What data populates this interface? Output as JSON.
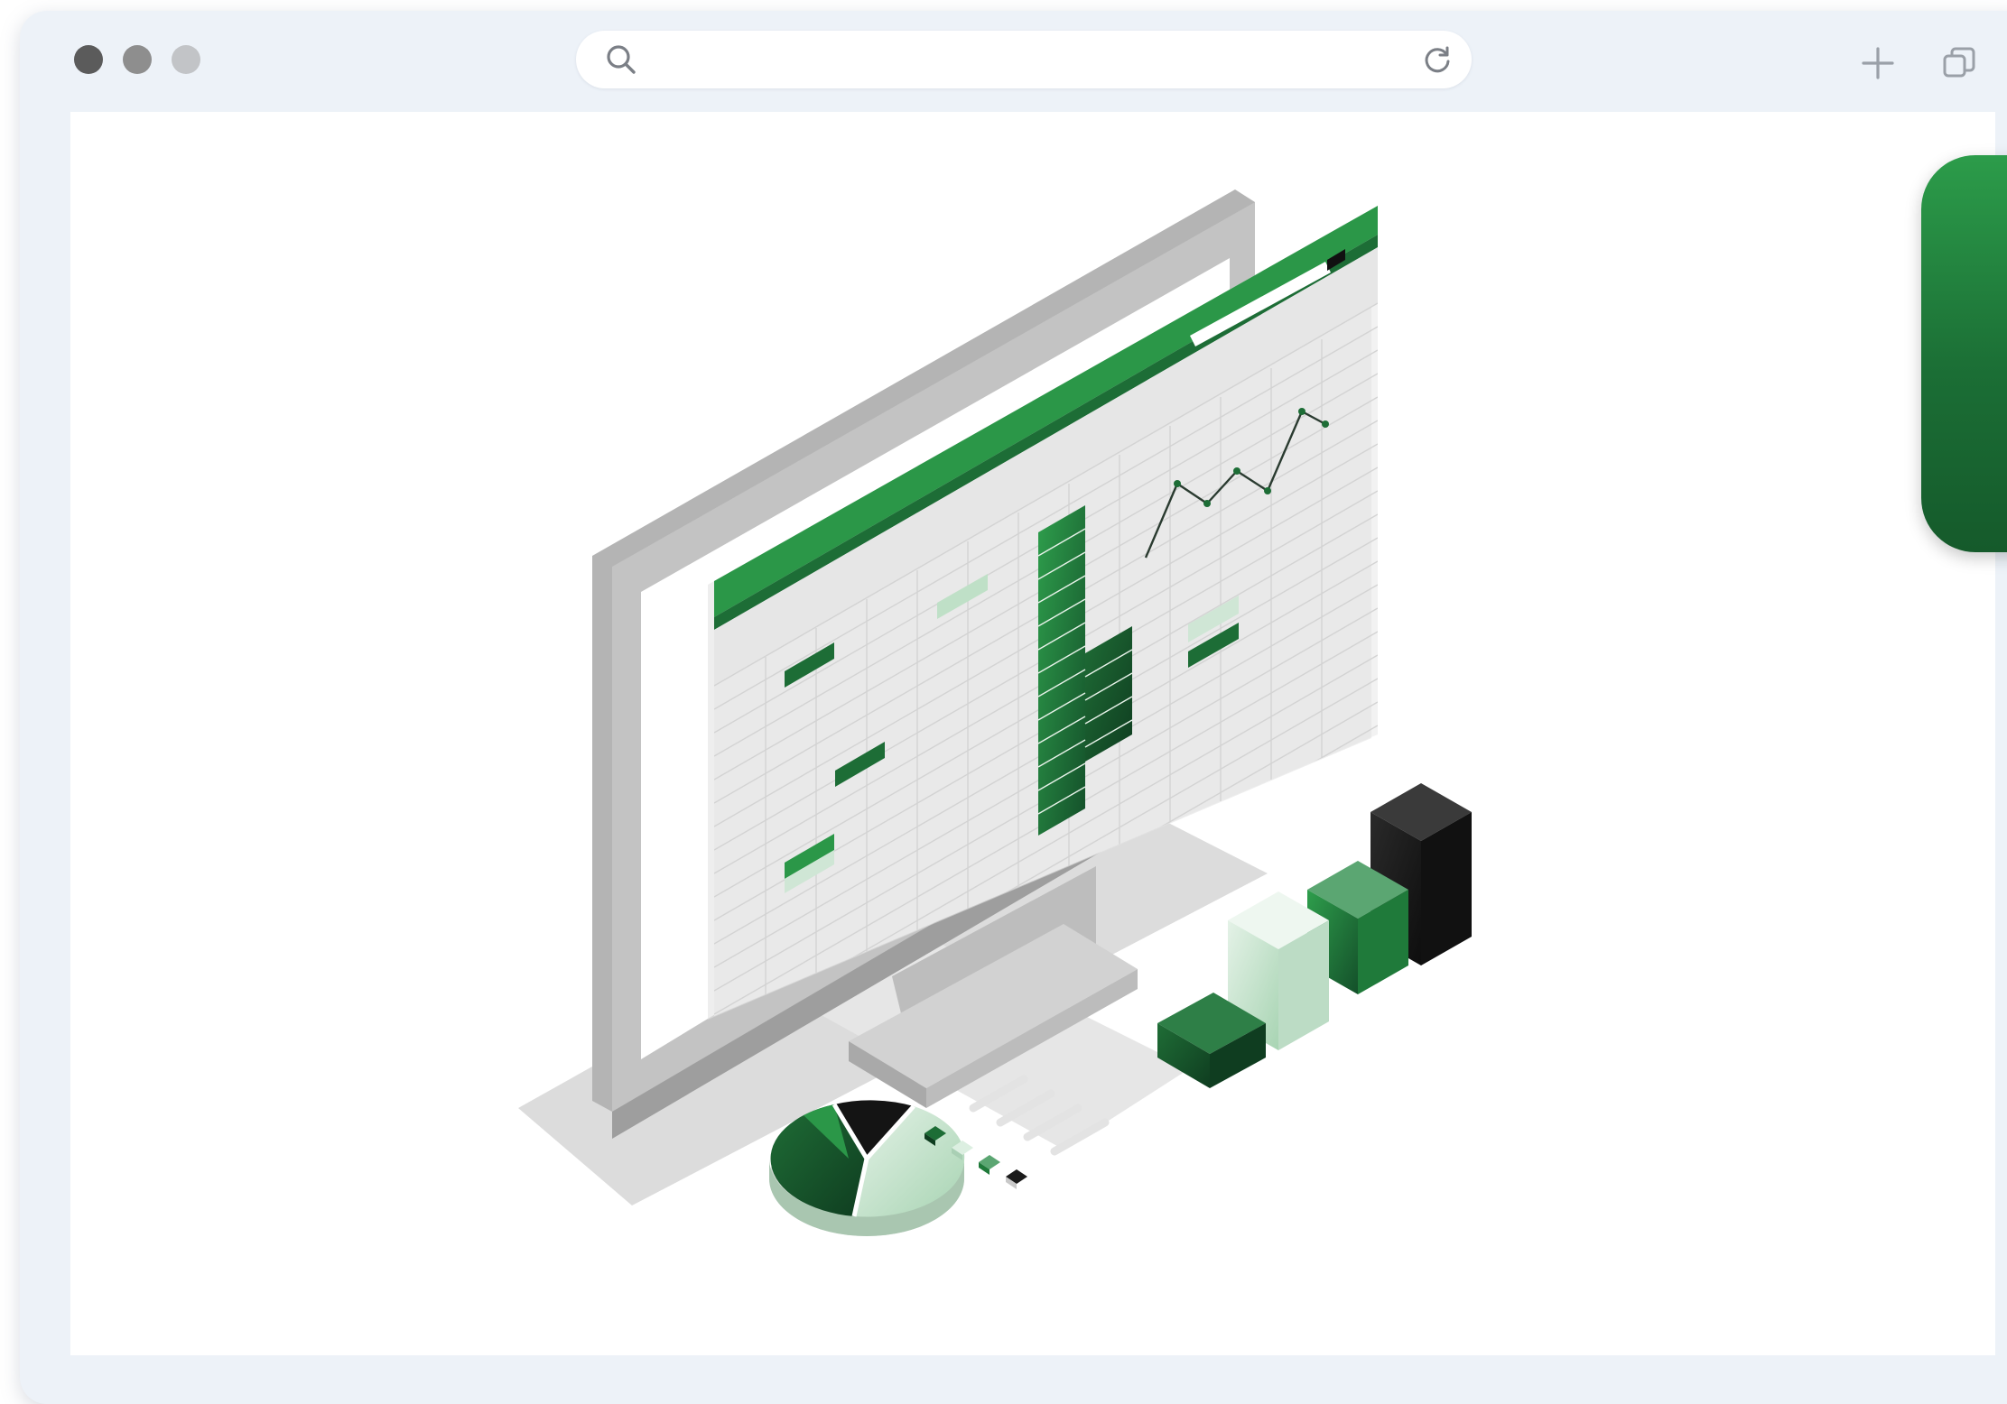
{
  "browser": {
    "address_bar": {
      "value": "",
      "placeholder": ""
    },
    "icons": {
      "search": "search-icon",
      "reload": "reload-icon",
      "new_tab": "plus-icon",
      "tabs": "tabs-icon"
    }
  },
  "illustration": {
    "subject": "spreadsheet-dashboard",
    "colors": {
      "dark_green": "#1b5e32",
      "green": "#2c9c4a",
      "light_green": "#c9e6d0",
      "black": "#1b1b1b",
      "monitor_gray": "#b9b9b9"
    }
  },
  "side_tab": {
    "color": "#1f7a3a"
  }
}
